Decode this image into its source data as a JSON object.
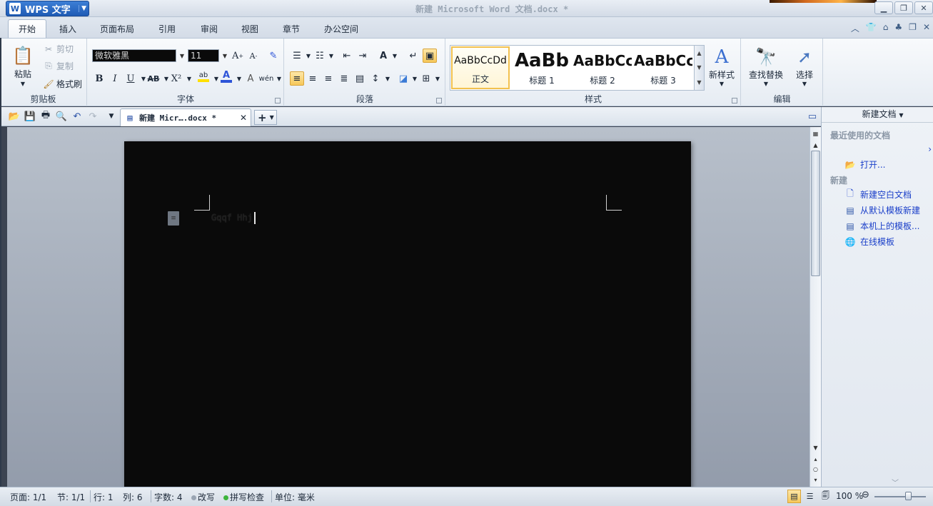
{
  "titlebar": {
    "app_button": "WPS 文字",
    "app_logo": "W",
    "title": "新建 Microsoft Word 文档.docx *",
    "controls": [
      "minimize",
      "restore",
      "close"
    ]
  },
  "menu": {
    "tabs": [
      "开始",
      "插入",
      "页面布局",
      "引用",
      "审阅",
      "视图",
      "章节",
      "办公空间"
    ],
    "active": "开始",
    "right_icons": [
      "chevron-up-icon",
      "skin-icon",
      "home-icon",
      "feedback-icon",
      "restore-small-icon",
      "close-small-icon"
    ]
  },
  "ribbon": {
    "clipboard": {
      "paste": "粘贴",
      "cut": "剪切",
      "copy": "复制",
      "format_painter": "格式刷",
      "label": "剪贴板"
    },
    "font": {
      "font_name": "微软雅黑",
      "font_size": "11",
      "bold": "B",
      "italic": "I",
      "underline": "U",
      "strikethrough": "AB",
      "superscript": "X²",
      "label": "字体",
      "highlight_color": "#ffe000",
      "font_color": "#2d54d8"
    },
    "paragraph": {
      "label": "段落"
    },
    "styles": {
      "items": [
        {
          "sample": "AaBbCcDd",
          "name": "正文"
        },
        {
          "sample": "AaBb",
          "name": "标题 1"
        },
        {
          "sample": "AaBbCc",
          "name": "标题 2"
        },
        {
          "sample": "AaBbCc",
          "name": "标题 3"
        }
      ],
      "new_style": "新样式",
      "label": "样式"
    },
    "editing": {
      "find_replace": "查找替换",
      "select": "选择",
      "label": "编辑"
    }
  },
  "doc_tab": {
    "title": "新建 Micr….docx *"
  },
  "document": {
    "text": "Gqqf Hhj"
  },
  "taskpane": {
    "title": "新建文档",
    "recent_heading": "最近使用的文档",
    "open_label": "打开...",
    "new_heading": "新建",
    "links": [
      "新建空白文档",
      "从默认模板新建",
      "本机上的模板...",
      "在线模板"
    ]
  },
  "statusbar": {
    "page": "页面: 1/1",
    "section": "节: 1/1",
    "line": "行: 1",
    "column": "列: 6",
    "word_count": "字数: 4",
    "track_changes": "改写",
    "spell_check": "拼写检查",
    "unit": "单位: 毫米",
    "zoom": "100 %"
  }
}
